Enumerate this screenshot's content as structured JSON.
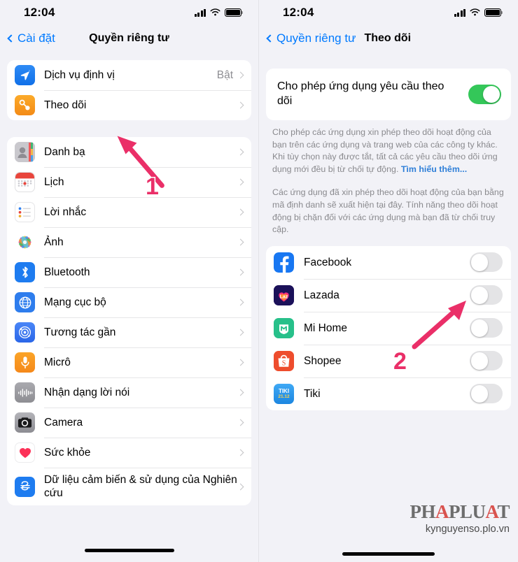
{
  "accent": {
    "ios_blue": "#007aff",
    "toggle_on_green": "#34c759",
    "annotation_pink": "#ea2f68",
    "secondary_gray": "#8e8e93"
  },
  "left_phone": {
    "status": {
      "time": "12:04",
      "cellular_icon": "signal-bars-icon",
      "wifi_icon": "wifi-icon",
      "battery_icon": "battery-full-icon"
    },
    "nav": {
      "back_label": "Cài đặt",
      "title": "Quyền riêng tư"
    },
    "group_top": {
      "rows": [
        {
          "icon": "location-services-icon",
          "label": "Dịch vụ định vị",
          "value": "Bật"
        },
        {
          "icon": "tracking-icon",
          "label": "Theo dõi",
          "value": ""
        }
      ]
    },
    "group_main": {
      "rows": [
        {
          "icon": "contacts-icon",
          "label": "Danh bạ"
        },
        {
          "icon": "calendar-icon",
          "label": "Lịch"
        },
        {
          "icon": "reminders-icon",
          "label": "Lời nhắc"
        },
        {
          "icon": "photos-icon",
          "label": "Ảnh"
        },
        {
          "icon": "bluetooth-icon",
          "label": "Bluetooth"
        },
        {
          "icon": "local-network-icon",
          "label": "Mạng cục bộ"
        },
        {
          "icon": "nearby-interactions-icon",
          "label": "Tương tác gần"
        },
        {
          "icon": "microphone-icon",
          "label": "Micrô"
        },
        {
          "icon": "speech-recognition-icon",
          "label": "Nhận dạng lời nói"
        },
        {
          "icon": "camera-icon",
          "label": "Camera"
        },
        {
          "icon": "health-icon",
          "label": "Sức khỏe"
        },
        {
          "icon": "research-sensor-icon",
          "label": "Dữ liệu cảm biến & sử dụng của Nghiên cứu"
        }
      ]
    },
    "annotation": {
      "step": "1"
    }
  },
  "right_phone": {
    "status": {
      "time": "12:04",
      "cellular_icon": "signal-bars-icon",
      "wifi_icon": "wifi-icon",
      "battery_icon": "battery-full-icon"
    },
    "nav": {
      "back_label": "Quyền riêng tư",
      "title": "Theo dõi"
    },
    "master_toggle": {
      "label": "Cho phép ứng dụng yêu cầu theo dõi",
      "state": "on"
    },
    "footnote_1": "Cho phép các ứng dụng xin phép theo dõi hoạt động của bạn trên các ứng dụng và trang web của các công ty khác. Khi tùy chọn này được tắt, tất cả các yêu cầu theo dõi ứng dụng mới đều bị từ chối tự động. ",
    "footnote_1_link": "Tìm hiểu thêm...",
    "footnote_2": "Các ứng dụng đã xin phép theo dõi hoạt động của bạn bằng mã định danh sẽ xuất hiện tại đây. Tính năng theo dõi hoạt động bị chặn đối với các ứng dụng mà bạn đã từ chối truy cập.",
    "apps": [
      {
        "icon": "facebook-icon",
        "label": "Facebook",
        "state": "off"
      },
      {
        "icon": "lazada-icon",
        "label": "Lazada",
        "state": "off"
      },
      {
        "icon": "mi-home-icon",
        "label": "Mi Home",
        "state": "off"
      },
      {
        "icon": "shopee-icon",
        "label": "Shopee",
        "state": "off"
      },
      {
        "icon": "tiki-icon",
        "label": "Tiki",
        "state": "off"
      }
    ],
    "annotation": {
      "step": "2"
    },
    "watermark": {
      "logo_a": "PH",
      "logo_b": "A",
      "logo_c": "PLU",
      "logo_d": "A",
      "logo_e": "T",
      "url": "kynguyenso.plo.vn"
    }
  }
}
